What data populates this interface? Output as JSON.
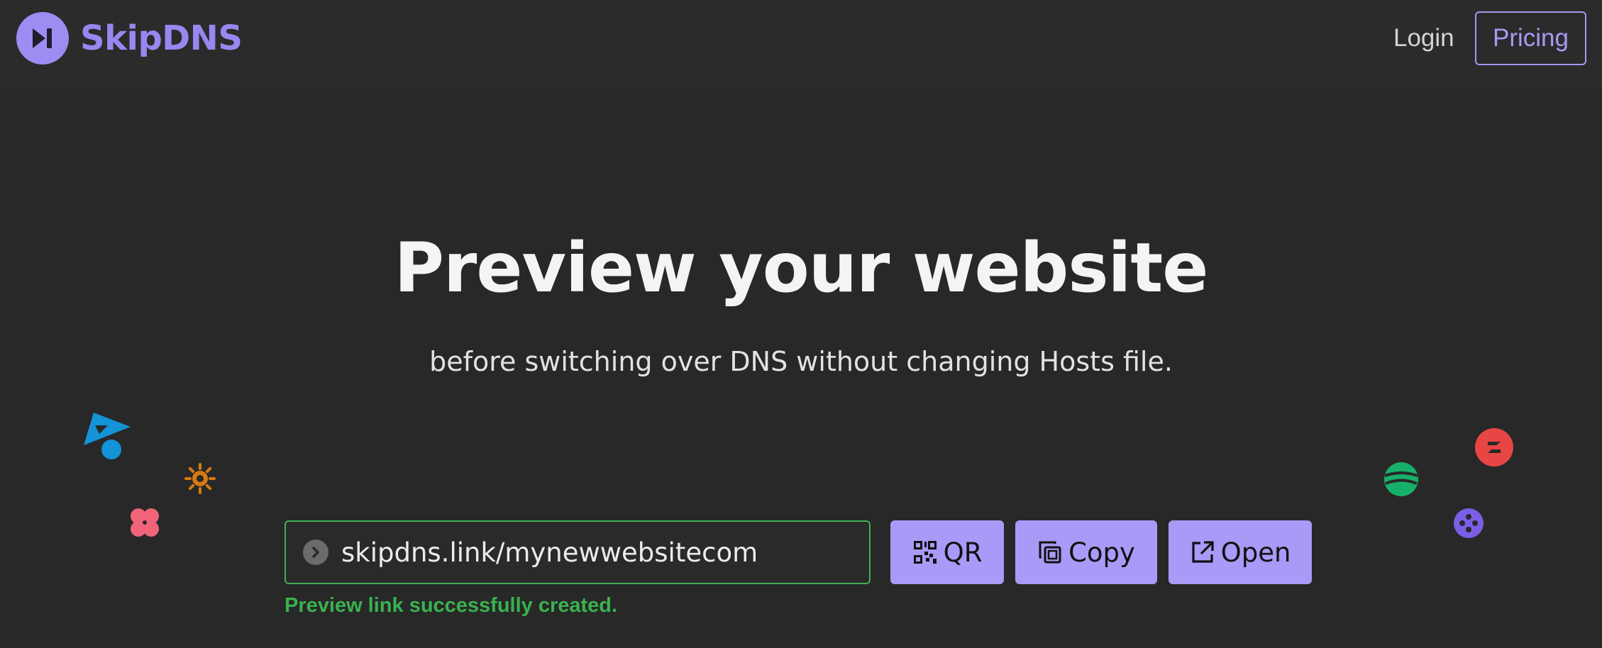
{
  "header": {
    "brand_name": "SkipDNS",
    "login_label": "Login",
    "pricing_label": "Pricing"
  },
  "hero": {
    "title": "Preview your website",
    "subtitle": "before switching over DNS without changing Hosts file."
  },
  "preview": {
    "link_value": "skipdns.link/mynewwebsitecom",
    "qr_label": "QR",
    "copy_label": "Copy",
    "open_label": "Open",
    "status_message": "Preview link successfully created."
  },
  "colors": {
    "background": "#282828",
    "accent": "#a89af6",
    "brand": "#9a86f0",
    "success": "#39b24f"
  },
  "icons": [
    "skip-forward-icon",
    "chevron-right-icon",
    "qr-code-icon",
    "copy-icon",
    "external-link-icon"
  ]
}
